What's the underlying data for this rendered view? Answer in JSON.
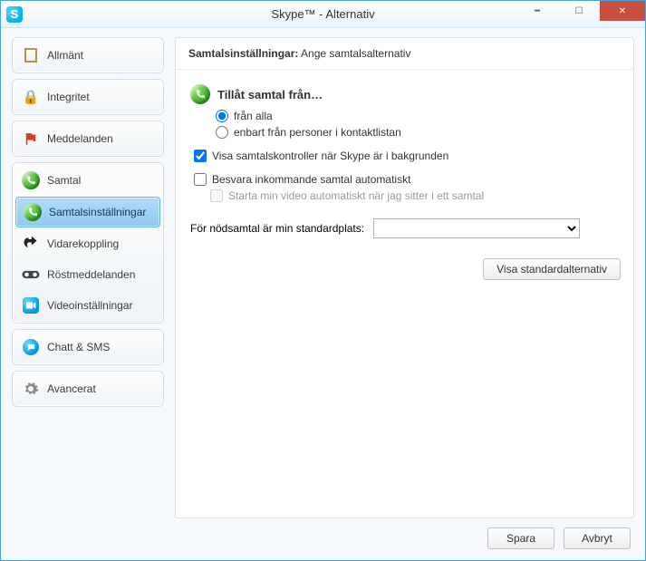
{
  "window": {
    "title": "Skype™ - Alternativ"
  },
  "sidebar": {
    "general": "Allmänt",
    "privacy": "Integritet",
    "notifications": "Meddelanden",
    "calls": "Samtal",
    "call_settings": "Samtalsinställningar",
    "forwarding": "Vidarekoppling",
    "voicemail": "Röstmeddelanden",
    "video": "Videoinställningar",
    "chat": "Chatt & SMS",
    "advanced": "Avancerat"
  },
  "panel": {
    "header_bold": "Samtalsinställningar:",
    "header_rest": " Ange samtalsalternativ",
    "allow_calls_from": "Tillåt samtal från…",
    "radio_all": "från alla",
    "radio_contacts": "enbart från personer i kontaktlistan",
    "check_showcontrols": "Visa samtalskontroller när Skype är i bakgrunden",
    "check_autoanswer": "Besvara inkommande samtal automatiskt",
    "check_startvideo": "Starta min video automatiskt när jag sitter i ett samtal",
    "emergency_label": "För nödsamtal är min standardplats:",
    "show_default_btn": "Visa standardalternativ"
  },
  "footer": {
    "save": "Spara",
    "cancel": "Avbryt"
  }
}
